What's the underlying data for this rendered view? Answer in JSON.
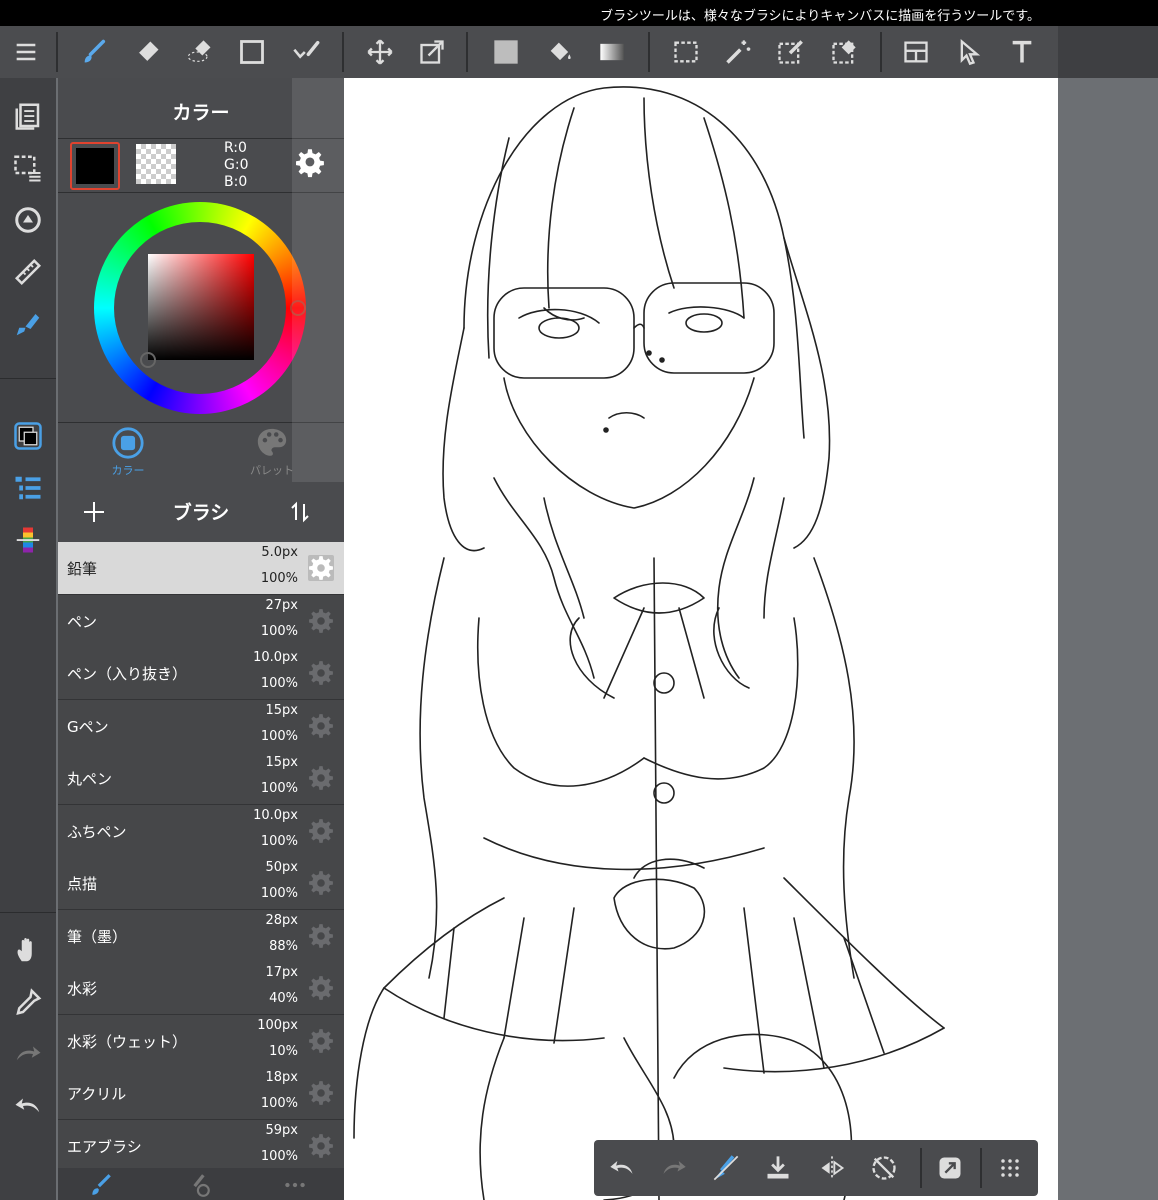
{
  "status_hint": "ブラシツールは、様々なブラシによりキャンバスに描画を行うツールです。",
  "color_panel": {
    "title": "カラー",
    "r": "R:0",
    "g": "G:0",
    "b": "B:0",
    "tab_color": "カラー",
    "tab_palette": "パレット",
    "accent": "#4aa0e6"
  },
  "brush_panel": {
    "title": "ブラシ",
    "items": [
      {
        "name": "鉛筆",
        "size": "5.0px",
        "opacity": "100%"
      },
      {
        "name": "ペン",
        "size": "27px",
        "opacity": "100%"
      },
      {
        "name": "ペン（入り抜き）",
        "size": "10.0px",
        "opacity": "100%"
      },
      {
        "name": "Gペン",
        "size": "15px",
        "opacity": "100%"
      },
      {
        "name": "丸ペン",
        "size": "15px",
        "opacity": "100%"
      },
      {
        "name": "ふちペン",
        "size": "10.0px",
        "opacity": "100%"
      },
      {
        "name": "点描",
        "size": "50px",
        "opacity": "100%"
      },
      {
        "name": "筆（墨）",
        "size": "28px",
        "opacity": "88%"
      },
      {
        "name": "水彩",
        "size": "17px",
        "opacity": "40%"
      },
      {
        "name": "水彩（ウェット）",
        "size": "100px",
        "opacity": "10%"
      },
      {
        "name": "アクリル",
        "size": "18px",
        "opacity": "100%"
      },
      {
        "name": "エアブラシ",
        "size": "59px",
        "opacity": "100%"
      }
    ]
  },
  "toolbar_icons": [
    "menu-icon",
    "brush-icon",
    "eraser-icon",
    "lasso-eraser-icon",
    "rectangle-icon",
    "check-brush-icon",
    "move-icon",
    "transform-icon",
    "fill-square-icon",
    "bucket-icon",
    "gradient-icon",
    "select-rect-icon",
    "magic-wand-icon",
    "select-pen-icon",
    "select-eraser-icon",
    "layout-icon",
    "select-cursor-icon",
    "text-icon"
  ],
  "left_icons": [
    "layers-icon",
    "selection-icon",
    "rotate-view-icon",
    "ruler-icon",
    "tool-brush-icon",
    "color-icon",
    "brush-list-icon",
    "color-bar-icon",
    "hand-icon",
    "eyedropper-icon",
    "redo-icon",
    "undo-icon"
  ],
  "bottom_icons": [
    "undo-icon",
    "redo-icon",
    "clear-icon",
    "save-icon",
    "flip-icon",
    "reset-rotation-icon",
    "share-icon",
    "grid-icon"
  ]
}
